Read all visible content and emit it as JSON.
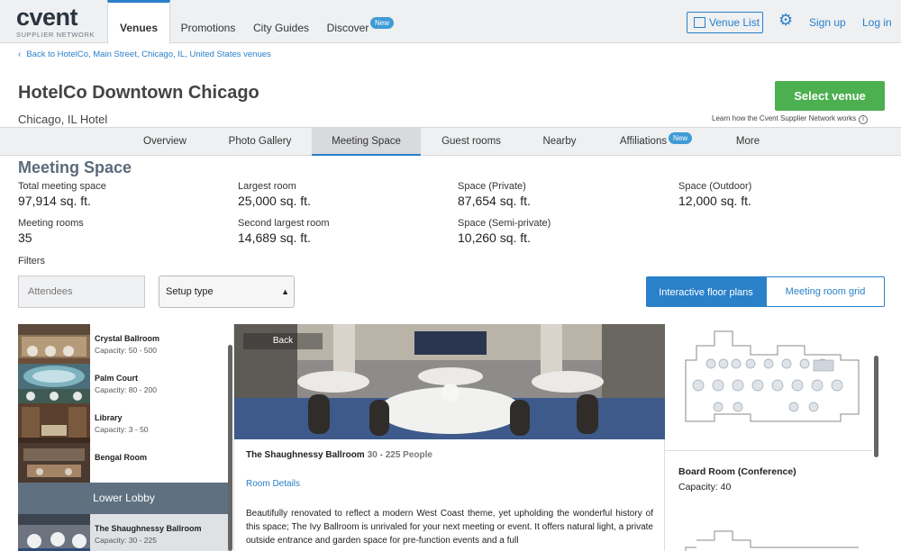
{
  "brand": {
    "logo_word": "cvent",
    "logo_sub": "SUPPLIER NETWORK"
  },
  "topnav": {
    "tabs": [
      {
        "label": "Venues",
        "active": true
      },
      {
        "label": "Promotions"
      },
      {
        "label": "City Guides"
      },
      {
        "label": "Discover",
        "badge": "New"
      }
    ],
    "venue_list_label": "Venue List",
    "sign_up": "Sign up",
    "log_in": "Log in"
  },
  "breadcrumb": {
    "back_label": "Back to HotelCo, Main Street, Chicago, IL, United States venues"
  },
  "venue": {
    "name": "HotelCo Downtown Chicago",
    "subtitle": "Chicago, IL Hotel",
    "select_label": "Select venue",
    "learn_label": "Learn how the Cvent Supplier Network works"
  },
  "subnav": {
    "tabs": [
      {
        "label": "Overview"
      },
      {
        "label": "Photo Gallery"
      },
      {
        "label": "Meeting Space",
        "active": true
      },
      {
        "label": "Guest rooms"
      },
      {
        "label": "Nearby"
      },
      {
        "label": "Affiliations",
        "badge": "New"
      },
      {
        "label": "More"
      }
    ]
  },
  "meeting_space": {
    "title": "Meeting Space",
    "stats": [
      {
        "label": "Total meeting space",
        "value": "97,914 sq. ft."
      },
      {
        "label": "Largest room",
        "value": "25,000 sq. ft."
      },
      {
        "label": "Space (Private)",
        "value": "87,654 sq. ft."
      },
      {
        "label": "Space (Outdoor)",
        "value": "12,000 sq. ft."
      },
      {
        "label": "Meeting rooms",
        "value": "35"
      },
      {
        "label": "Second largest room",
        "value": "14,689 sq. ft."
      },
      {
        "label": "Space (Semi-private)",
        "value": "10,260 sq. ft."
      }
    ]
  },
  "filters": {
    "label": "Filters",
    "attendees_placeholder": "Attendees",
    "setup_value": "Setup type",
    "view_interactive": "Interactive floor plans",
    "view_grid": "Meeting room grid"
  },
  "rooms": {
    "items": [
      {
        "name": "Crystal Ballroom",
        "capacity": "Capacity: 50 - 500"
      },
      {
        "name": "Palm Court",
        "capacity": "Capacity: 80 - 200"
      },
      {
        "name": "Library",
        "capacity": "Capacity: 3 - 50"
      },
      {
        "name": "Bengal Room",
        "capacity": ""
      }
    ],
    "group_header": "Lower Lobby",
    "selected": {
      "name": "The Shaughnessy Ballroom",
      "capacity": "Capacity: 30 - 225"
    }
  },
  "detail": {
    "back_label": "Back",
    "room_name": "The Shaughnessy Ballroom",
    "people": "30 - 225 People",
    "details_link": "Room Details",
    "description": "Beautifully renovated to reflect a modern West Coast theme, yet upholding the wonderful history of this space; The Ivy Ballroom is unrivaled for your next meeting or event. It offers natural light, a private outside entrance and garden space for pre-function events and a full"
  },
  "floorplan": {
    "room_name": "Board Room (Conference)",
    "capacity": "Capacity: 40"
  },
  "colors": {
    "accent": "#2a80c9",
    "select_green": "#4caf50",
    "group_header": "#5f7180"
  }
}
